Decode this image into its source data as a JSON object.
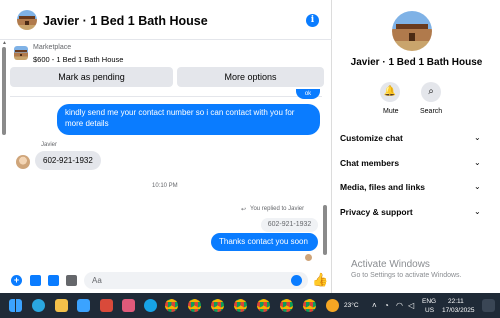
{
  "header": {
    "title": "Javier · 1 Bed 1 Bath House"
  },
  "marketplace": {
    "label": "Marketplace",
    "item": "$600 - 1 Bed 1 Bath House",
    "mark_pending": "Mark as pending",
    "more_options": "More options"
  },
  "messages": {
    "partial_top": "ok",
    "outgoing_1": "kindly send me your contact number so i can contact with you for more details",
    "sender_name": "Javier",
    "incoming_1": "602-921-1932",
    "timestamp": "10:10 PM",
    "replied_note": "You replied to Javier",
    "quoted": "602-921-1932",
    "outgoing_2": "Thanks contact you soon"
  },
  "composer": {
    "placeholder": "Aa"
  },
  "sidebar": {
    "title": "Javier · 1 Bed 1 Bath House",
    "mute": "Mute",
    "search": "Search",
    "sections": [
      "Customize chat",
      "Chat members",
      "Media, files and links",
      "Privacy & support"
    ]
  },
  "watermark": {
    "line1": "Activate Windows",
    "line2": "Go to Settings to activate Windows."
  },
  "taskbar": {
    "weather": "23°C",
    "lang1": "ENG",
    "lang2": "US",
    "time": "22:11",
    "date": "17/03/2025"
  },
  "colors": {
    "accent": "#0a7cff",
    "bubble_gray": "#e4e6eb",
    "taskbar": "#1f2a37"
  }
}
